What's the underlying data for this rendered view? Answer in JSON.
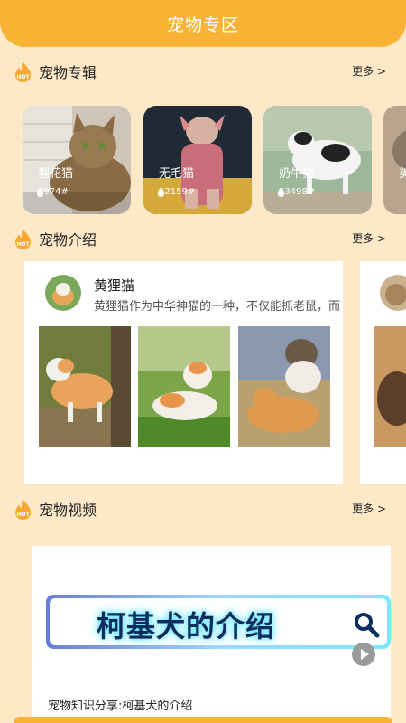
{
  "header": {
    "title": "宠物专区"
  },
  "sections": {
    "albums": {
      "title": "宠物专辑",
      "more": "更多 >"
    },
    "intro": {
      "title": "宠物介绍",
      "more": ""
    },
    "videos": {
      "title": "宠物视频",
      "more": "更多 >"
    }
  },
  "albums": [
    {
      "name": "狸花猫",
      "count": "#974#"
    },
    {
      "name": "无毛猫",
      "count": "#2159#"
    },
    {
      "name": "奶牛猫",
      "count": "#3498#"
    },
    {
      "name": "美",
      "count": ""
    }
  ],
  "intro_card": {
    "title": "黄狸猫",
    "desc": "黄狸猫作为中华神猫的一种，不仅能抓老鼠，而"
  },
  "video": {
    "banner_text": "柯基犬的介绍",
    "caption": "宠物知识分享:柯基犬的介绍"
  },
  "colors": {
    "accent": "#f8b335",
    "background": "#fde9c8"
  },
  "icons": [
    "hot-flame-icon",
    "search-icon",
    "play-icon"
  ]
}
